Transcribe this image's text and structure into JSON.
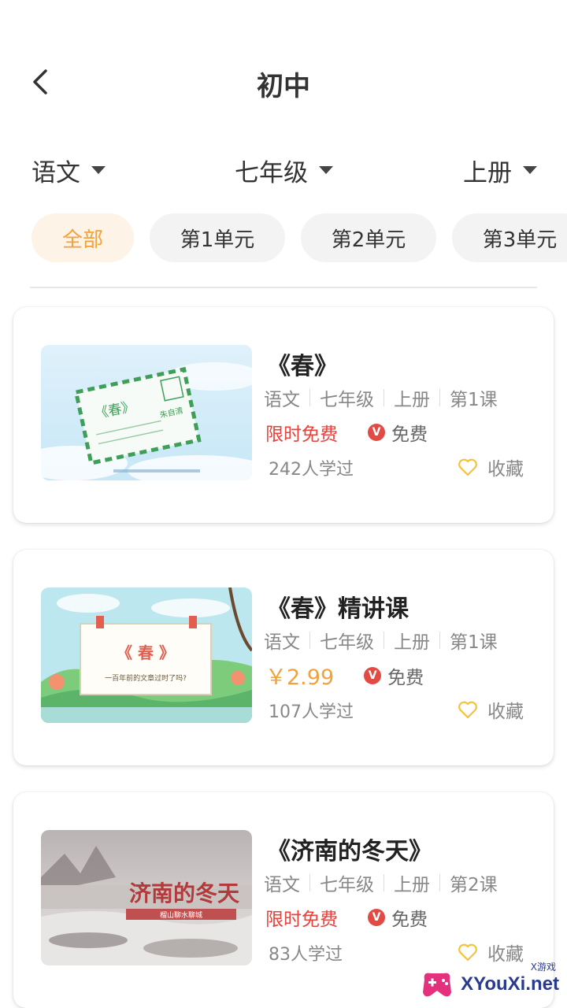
{
  "header": {
    "title": "初中",
    "back_icon": "chevron-left-icon"
  },
  "filters": {
    "subject": "语文",
    "grade": "七年级",
    "volume": "上册"
  },
  "units": [
    "全部",
    "第1单元",
    "第2单元",
    "第3单元"
  ],
  "colors": {
    "accent": "#f2a23a",
    "free_red": "#e8423c",
    "badge_red": "#e24b44",
    "fav_yellow": "#f6c23e"
  },
  "courses": [
    {
      "title": "《春》",
      "meta": [
        "语文",
        "七年级",
        "上册",
        "第1课"
      ],
      "price": "限时免费",
      "vip": "免费",
      "learned": "242人学过",
      "fav": "收藏",
      "thumb": {
        "envelope_text": "《春》",
        "author": "朱自清"
      }
    },
    {
      "title": "《春》精讲课",
      "meta": [
        "语文",
        "七年级",
        "上册",
        "第1课"
      ],
      "price": "￥2.99",
      "vip": "免费",
      "learned": "107人学过",
      "fav": "收藏",
      "thumb": {
        "board_title": "《 春 》",
        "board_sub": "一百年前的文章过时了吗?"
      }
    },
    {
      "title": "《济南的冬天》",
      "meta": [
        "语文",
        "七年级",
        "上册",
        "第2课"
      ],
      "price": "限时免费",
      "vip": "免费",
      "learned": "83人学过",
      "fav": "收藏",
      "thumb": {
        "art_text": "济南的冬天",
        "ribbon": "榴山聊水聊城"
      }
    }
  ],
  "watermark": {
    "text": "XYouXi.net",
    "top": "X游戏"
  }
}
